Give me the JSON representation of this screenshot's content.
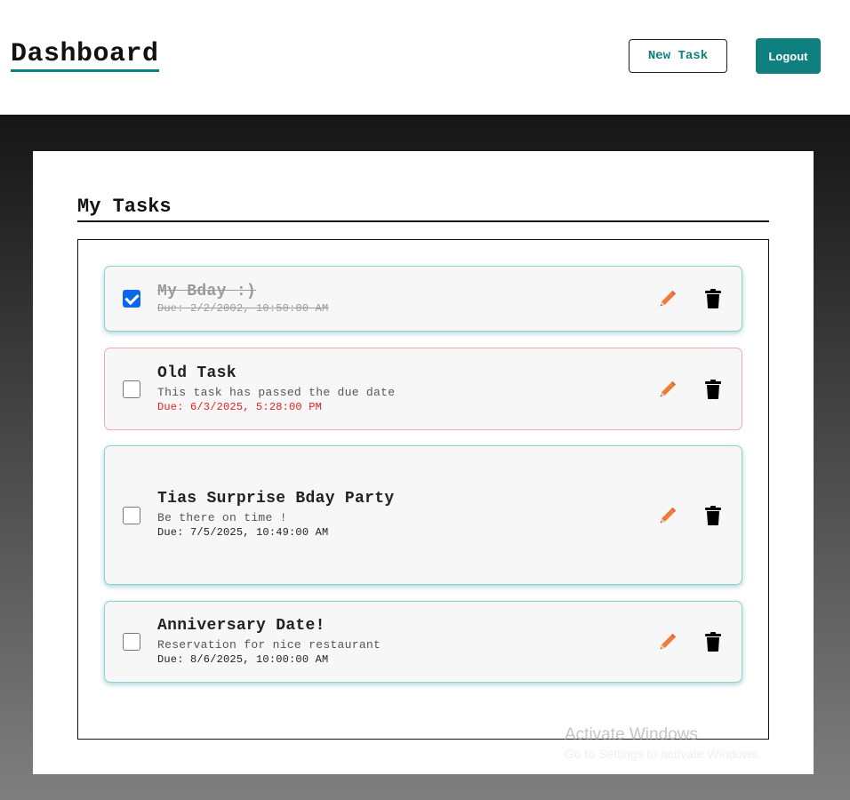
{
  "header": {
    "title": "Dashboard",
    "new_task_label": "New Task",
    "logout_label": "Logout"
  },
  "main": {
    "section_title": "My Tasks",
    "tasks": [
      {
        "title": "My Bday :)",
        "description": "",
        "due": "Due: 2/2/2002, 10:50:00 AM",
        "completed": true,
        "overdue": false
      },
      {
        "title": "Old Task",
        "description": "This task has passed the due date",
        "due": "Due: 6/3/2025, 5:28:00 PM",
        "completed": false,
        "overdue": true
      },
      {
        "title": "Tias Surprise Bday Party",
        "description": "Be there on time !",
        "due": "Due: 7/5/2025, 10:49:00 AM",
        "completed": false,
        "overdue": false
      },
      {
        "title": "Anniversary Date!",
        "description": "Reservation for nice restaurant",
        "due": "Due: 8/6/2025, 10:00:00 AM",
        "completed": false,
        "overdue": false
      }
    ]
  },
  "watermark": {
    "line1": "Activate Windows",
    "line2": "Go to Settings to activate Windows."
  },
  "colors": {
    "accent": "#0f7f7f",
    "checkbox_checked": "#0b68e8",
    "overdue_text": "#e21f1f",
    "edit_icon": "#f07c3a"
  },
  "icons": {
    "edit": "pencil-icon",
    "delete": "trash-icon"
  }
}
